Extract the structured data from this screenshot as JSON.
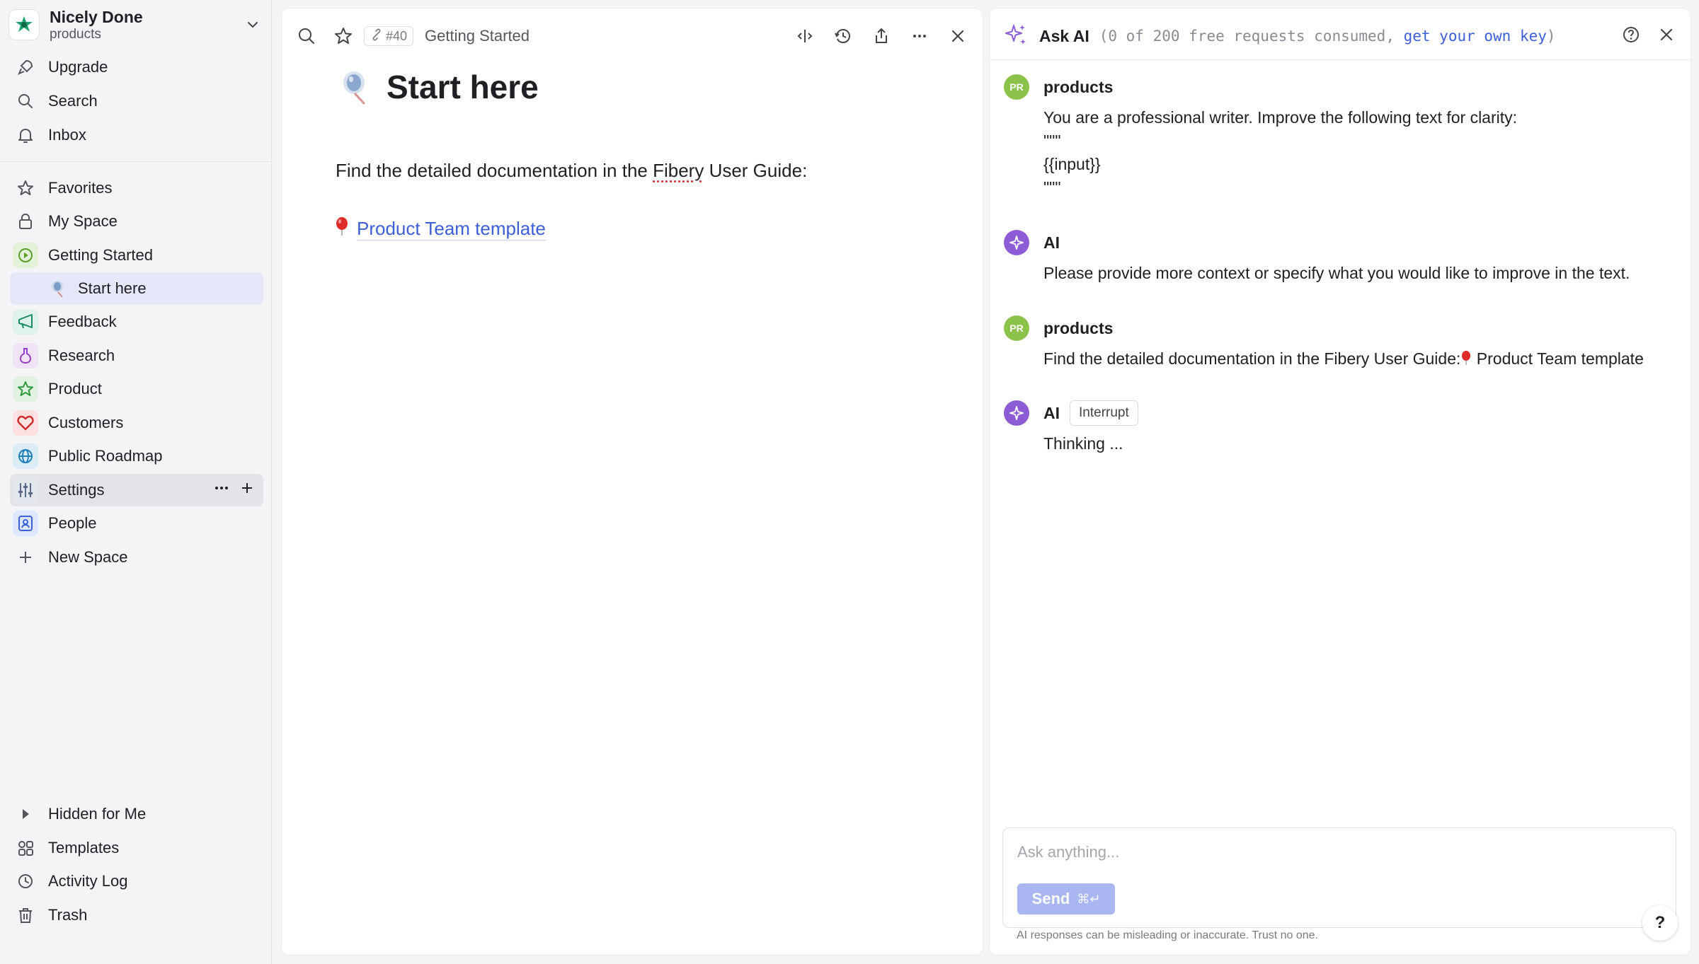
{
  "workspace": {
    "name": "Nicely Done",
    "subtitle": "products"
  },
  "sidebar": {
    "top_items": [
      {
        "label": "Upgrade",
        "icon": "rocket-icon"
      },
      {
        "label": "Search",
        "icon": "search-icon"
      },
      {
        "label": "Inbox",
        "icon": "bell-icon"
      }
    ],
    "items": [
      {
        "label": "Favorites",
        "icon": "star-icon"
      },
      {
        "label": "My Space",
        "icon": "lock-icon"
      },
      {
        "label": "Getting Started",
        "icon": "play-icon"
      },
      {
        "label": "Start here",
        "icon": "page-emoji-icon"
      },
      {
        "label": "Feedback",
        "icon": "megaphone-icon"
      },
      {
        "label": "Research",
        "icon": "flask-icon"
      },
      {
        "label": "Product",
        "icon": "star-icon"
      },
      {
        "label": "Customers",
        "icon": "heart-icon"
      },
      {
        "label": "Public Roadmap",
        "icon": "globe-icon"
      },
      {
        "label": "Settings",
        "icon": "sliders-icon"
      },
      {
        "label": "People",
        "icon": "person-badge-icon"
      },
      {
        "label": "New Space",
        "icon": "plus-icon"
      }
    ],
    "bottom_items": [
      {
        "label": "Hidden for Me",
        "icon": "triangle-right-icon"
      },
      {
        "label": "Templates",
        "icon": "templates-icon"
      },
      {
        "label": "Activity Log",
        "icon": "clock-icon"
      },
      {
        "label": "Trash",
        "icon": "trash-icon"
      }
    ]
  },
  "doc": {
    "ref": "#40",
    "breadcrumb": "Getting Started",
    "title": "Start here",
    "para_before": "Find the detailed documentation in the ",
    "para_spell": "Fibery",
    "para_after": " User Guide:",
    "link_text": "Product Team template"
  },
  "ai": {
    "title": "Ask AI",
    "quota_prefix": "(0 of 200 free requests consumed, ",
    "quota_link": "get your own key",
    "quota_suffix": ")",
    "messages": [
      {
        "author": "products",
        "avatar": "PR",
        "body": "You are a professional writer. Improve the following text for clarity:\n\"\"\"\n{{input}}\n\"\"\""
      },
      {
        "author": "AI",
        "body": "Please provide more context or specify what you would like to improve in the text."
      },
      {
        "author": "products",
        "avatar": "PR",
        "body_before": "Find the detailed documentation in the Fibery User Guide:",
        "body_after": " Product Team template"
      },
      {
        "author": "AI",
        "badge": "Interrupt",
        "body": "Thinking ..."
      }
    ],
    "composer_placeholder": "Ask anything...",
    "send_label": "Send",
    "send_shortcut": "⌘↵",
    "disclaimer": "AI responses can be misleading or inaccurate. Trust no one."
  },
  "help_label": "?",
  "colors": {
    "accent": "#3d5fd6",
    "ai_purple": "#8e5bd6",
    "avatar_green": "#8bc34a",
    "selected_bg": "#e6e8fa"
  }
}
